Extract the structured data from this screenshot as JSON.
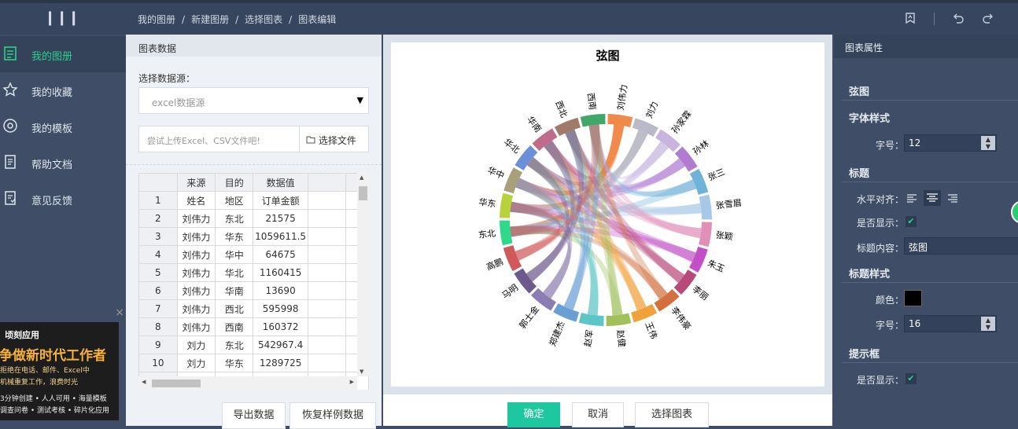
{
  "topbar": {
    "menu_icon": "menu-icon",
    "breadcrumb": [
      "我的图册",
      "新建图册",
      "选择图表",
      "图表编辑"
    ],
    "separator": "/",
    "icons": [
      "save-icon",
      "undo-icon",
      "redo-icon"
    ]
  },
  "sidebar": {
    "items": [
      {
        "label": "我的图册",
        "icon": "album-icon",
        "active": true
      },
      {
        "label": "我的收藏",
        "icon": "star-icon",
        "active": false
      },
      {
        "label": "我的模板",
        "icon": "template-icon",
        "active": false
      },
      {
        "label": "帮助文档",
        "icon": "document-icon",
        "active": false
      },
      {
        "label": "意见反馈",
        "icon": "feedback-icon",
        "active": false
      }
    ],
    "accent": "#27d18c"
  },
  "ad": {
    "brand": "顷刻应用",
    "headline": "争做新时代工作者",
    "line1": "拒绝在电话、邮件、Excel中",
    "line2": "机械重复工作，浪费时光",
    "line3": "3分钟创建 • 人人可用 • 海量模板",
    "line4": "调查问卷 • 测试考核 • 碎片化应用",
    "close": "×"
  },
  "data_panel": {
    "title": "图表数据",
    "source_label": "选择数据源：",
    "source_value": "excel数据源",
    "upload_placeholder": "尝试上传Excel、CSV文件吧!",
    "file_button": "选择文件",
    "table": {
      "headers": [
        "",
        "来源",
        "目的",
        "数据值",
        ""
      ],
      "rows": [
        [
          "1",
          "姓名",
          "地区",
          "订单金额",
          ""
        ],
        [
          "2",
          "刘伟力",
          "东北",
          "21575",
          ""
        ],
        [
          "3",
          "刘伟力",
          "华东",
          "1059611.5",
          ""
        ],
        [
          "4",
          "刘伟力",
          "华中",
          "64675",
          ""
        ],
        [
          "5",
          "刘伟力",
          "华北",
          "1160415",
          ""
        ],
        [
          "6",
          "刘伟力",
          "华南",
          "13690",
          ""
        ],
        [
          "7",
          "刘伟力",
          "西北",
          "595998",
          ""
        ],
        [
          "8",
          "刘伟力",
          "西南",
          "160372",
          ""
        ],
        [
          "9",
          "刘力",
          "东北",
          "542967.4",
          ""
        ],
        [
          "10",
          "刘力",
          "华东",
          "1289725",
          ""
        ]
      ]
    },
    "export_button": "导出数据",
    "restore_button": "恢复样例数据"
  },
  "chart": {
    "title": "弦图"
  },
  "chart_data": {
    "type": "chord",
    "title": "弦图",
    "nodes": [
      {
        "name": "刘伟力",
        "color": "#f08a4b"
      },
      {
        "name": "刘力",
        "color": "#b9b9c8"
      },
      {
        "name": "孙家霖",
        "color": "#c7b5e0"
      },
      {
        "name": "孙林",
        "color": "#b07bd0"
      },
      {
        "name": "张三",
        "color": "#6fb3d9"
      },
      {
        "name": "张雪眉",
        "color": "#a9c8e8"
      },
      {
        "name": "张颖",
        "color": "#e08fb6"
      },
      {
        "name": "朱玉",
        "color": "#c24fc8"
      },
      {
        "name": "李丽",
        "color": "#b84a7a"
      },
      {
        "name": "李伟豪",
        "color": "#d2703f"
      },
      {
        "name": "王伟",
        "color": "#f0a13a"
      },
      {
        "name": "赵健",
        "color": "#9fc05a"
      },
      {
        "name": "赵军",
        "color": "#5cc6c6"
      },
      {
        "name": "郑建杰",
        "color": "#6a9fd6"
      },
      {
        "name": "郭士金",
        "color": "#8b7db3"
      },
      {
        "name": "马明",
        "color": "#6d5a8c"
      },
      {
        "name": "高鹏",
        "color": "#d05a5a"
      },
      {
        "name": "东北",
        "color": "#2fd98a"
      },
      {
        "name": "华东",
        "color": "#b8d23a"
      },
      {
        "name": "华中",
        "color": "#a8a07a"
      },
      {
        "name": "华北",
        "color": "#6b8fd9"
      },
      {
        "name": "华南",
        "color": "#c06b8c"
      },
      {
        "name": "西北",
        "color": "#a07a6a"
      },
      {
        "name": "西南",
        "color": "#3fa86a"
      }
    ],
    "links": [
      {
        "source": "刘伟力",
        "target": "东北",
        "value": 21575
      },
      {
        "source": "刘伟力",
        "target": "华东",
        "value": 1059611.5
      },
      {
        "source": "刘伟力",
        "target": "华中",
        "value": 64675
      },
      {
        "source": "刘伟力",
        "target": "华北",
        "value": 1160415
      },
      {
        "source": "刘伟力",
        "target": "华南",
        "value": 13690
      },
      {
        "source": "刘伟力",
        "target": "西北",
        "value": 595998
      },
      {
        "source": "刘伟力",
        "target": "西南",
        "value": 160372
      },
      {
        "source": "刘力",
        "target": "东北",
        "value": 542967.4
      },
      {
        "source": "刘力",
        "target": "华东",
        "value": 1289725
      }
    ]
  },
  "actions": {
    "confirm": "确定",
    "cancel": "取消",
    "choose_chart": "选择图表",
    "confirm_color": "#1dc8a0"
  },
  "props": {
    "title": "图表属性",
    "chart_name": "弦图",
    "font_style_label": "字体样式",
    "font_size_label": "字号：",
    "font_size_value": "12",
    "title_section": "标题",
    "align_label": "水平对齐：",
    "show_label": "是否显示：",
    "title_content_label": "标题内容：",
    "title_content_value": "弦图",
    "title_style_section": "标题样式",
    "color_label": "颜色：",
    "title_color": "#000000",
    "title_font_size_label": "字号：",
    "title_font_size_value": "16",
    "tooltip_section": "提示框",
    "tooltip_show_label": "是否显示：",
    "check": "✔"
  }
}
